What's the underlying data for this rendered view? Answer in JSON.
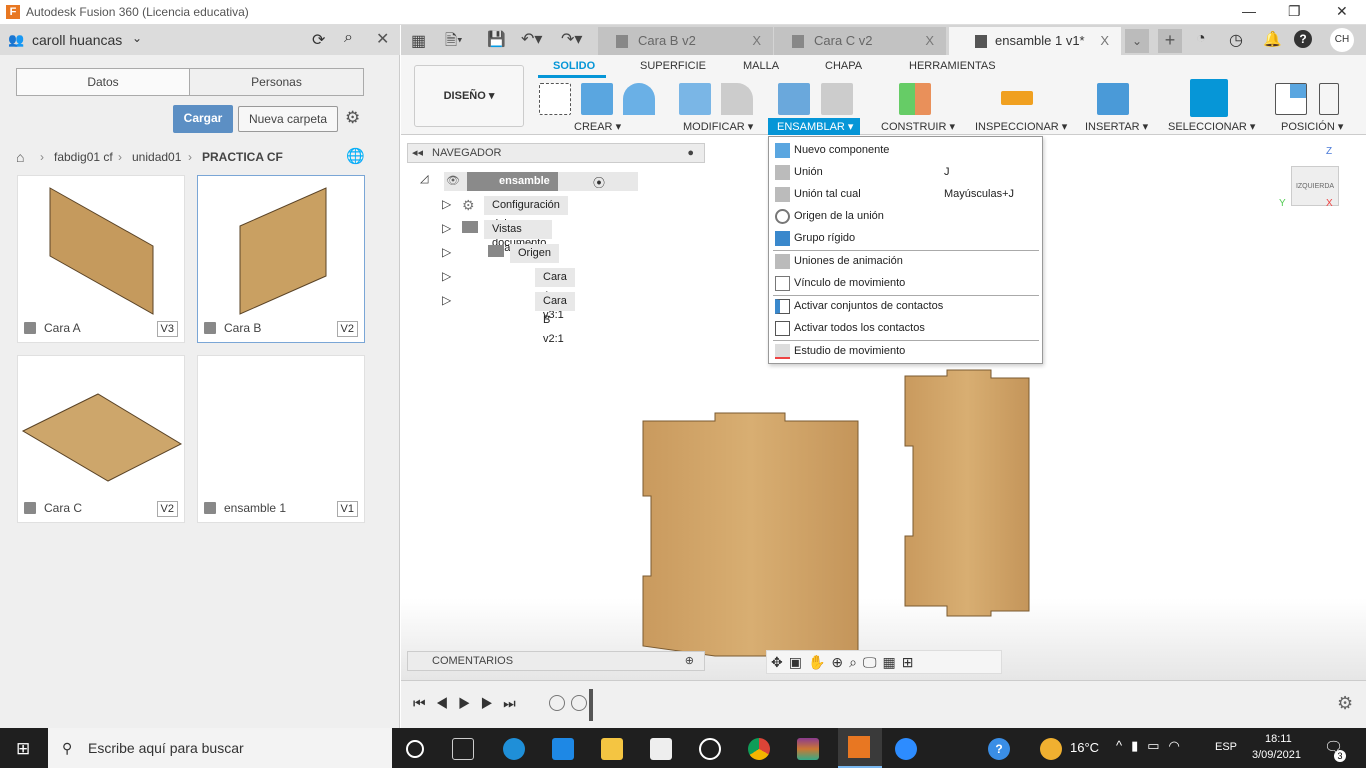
{
  "window": {
    "title": "Autodesk Fusion 360 (Licencia educativa)",
    "logo": "F"
  },
  "left_panel": {
    "user": "caroll huancas",
    "tabs": [
      "Datos",
      "Personas"
    ],
    "upload": "Cargar",
    "new_folder": "Nueva carpeta",
    "breadcrumb": [
      "fabdig01 cf",
      "unidad01",
      "PRACTICA CF"
    ],
    "files": [
      {
        "name": "Cara A",
        "version": "V3"
      },
      {
        "name": "Cara B",
        "version": "V2"
      },
      {
        "name": "Cara C",
        "version": "V2"
      },
      {
        "name": "ensamble 1",
        "version": "V1"
      }
    ]
  },
  "tabs": [
    {
      "label": "Cara B v2"
    },
    {
      "label": "Cara C v2"
    },
    {
      "label": "ensamble 1 v1*"
    }
  ],
  "avatar": "CH",
  "toolbar": {
    "workspace": "DISEÑO",
    "tabs": [
      "SOLIDO",
      "SUPERFICIE",
      "MALLA",
      "CHAPA",
      "HERRAMIENTAS"
    ],
    "groups": [
      "CREAR",
      "MODIFICAR",
      "ENSAMBLAR",
      "CONSTRUIR",
      "INSPECCIONAR",
      "INSERTAR",
      "SELECCIONAR",
      "POSICIÓN"
    ],
    "accent": "#0696d7"
  },
  "navigator": {
    "title": "NAVEGADOR",
    "root": "ensamble 1 v0",
    "items": [
      "Configuración del documento",
      "Vistas guardadas",
      "Origen",
      "Cara A v3:1",
      "Cara B v2:1"
    ]
  },
  "menu": {
    "items": [
      {
        "label": "Nuevo componente",
        "shortcut": ""
      },
      {
        "label": "Unión",
        "shortcut": "J"
      },
      {
        "label": "Unión tal cual",
        "shortcut": "Mayúsculas+J"
      },
      {
        "label": "Origen de la unión",
        "shortcut": ""
      },
      {
        "label": "Grupo rígido",
        "shortcut": ""
      },
      {
        "label": "Uniones de animación",
        "shortcut": ""
      },
      {
        "label": "Vínculo de movimiento",
        "shortcut": ""
      },
      {
        "label": "Activar conjuntos de contactos",
        "shortcut": ""
      },
      {
        "label": "Activar todos los contactos",
        "shortcut": ""
      },
      {
        "label": "Estudio de movimiento",
        "shortcut": ""
      }
    ]
  },
  "viewcube": {
    "face": "IZQUIERDA",
    "axes": [
      "Z",
      "Y",
      "X"
    ]
  },
  "comments": "COMENTARIOS",
  "taskbar": {
    "search": "Escribe aquí para buscar",
    "weather": "16°C",
    "lang": "ESP",
    "time": "18:11",
    "date": "3/09/2021",
    "notifications": "3"
  }
}
